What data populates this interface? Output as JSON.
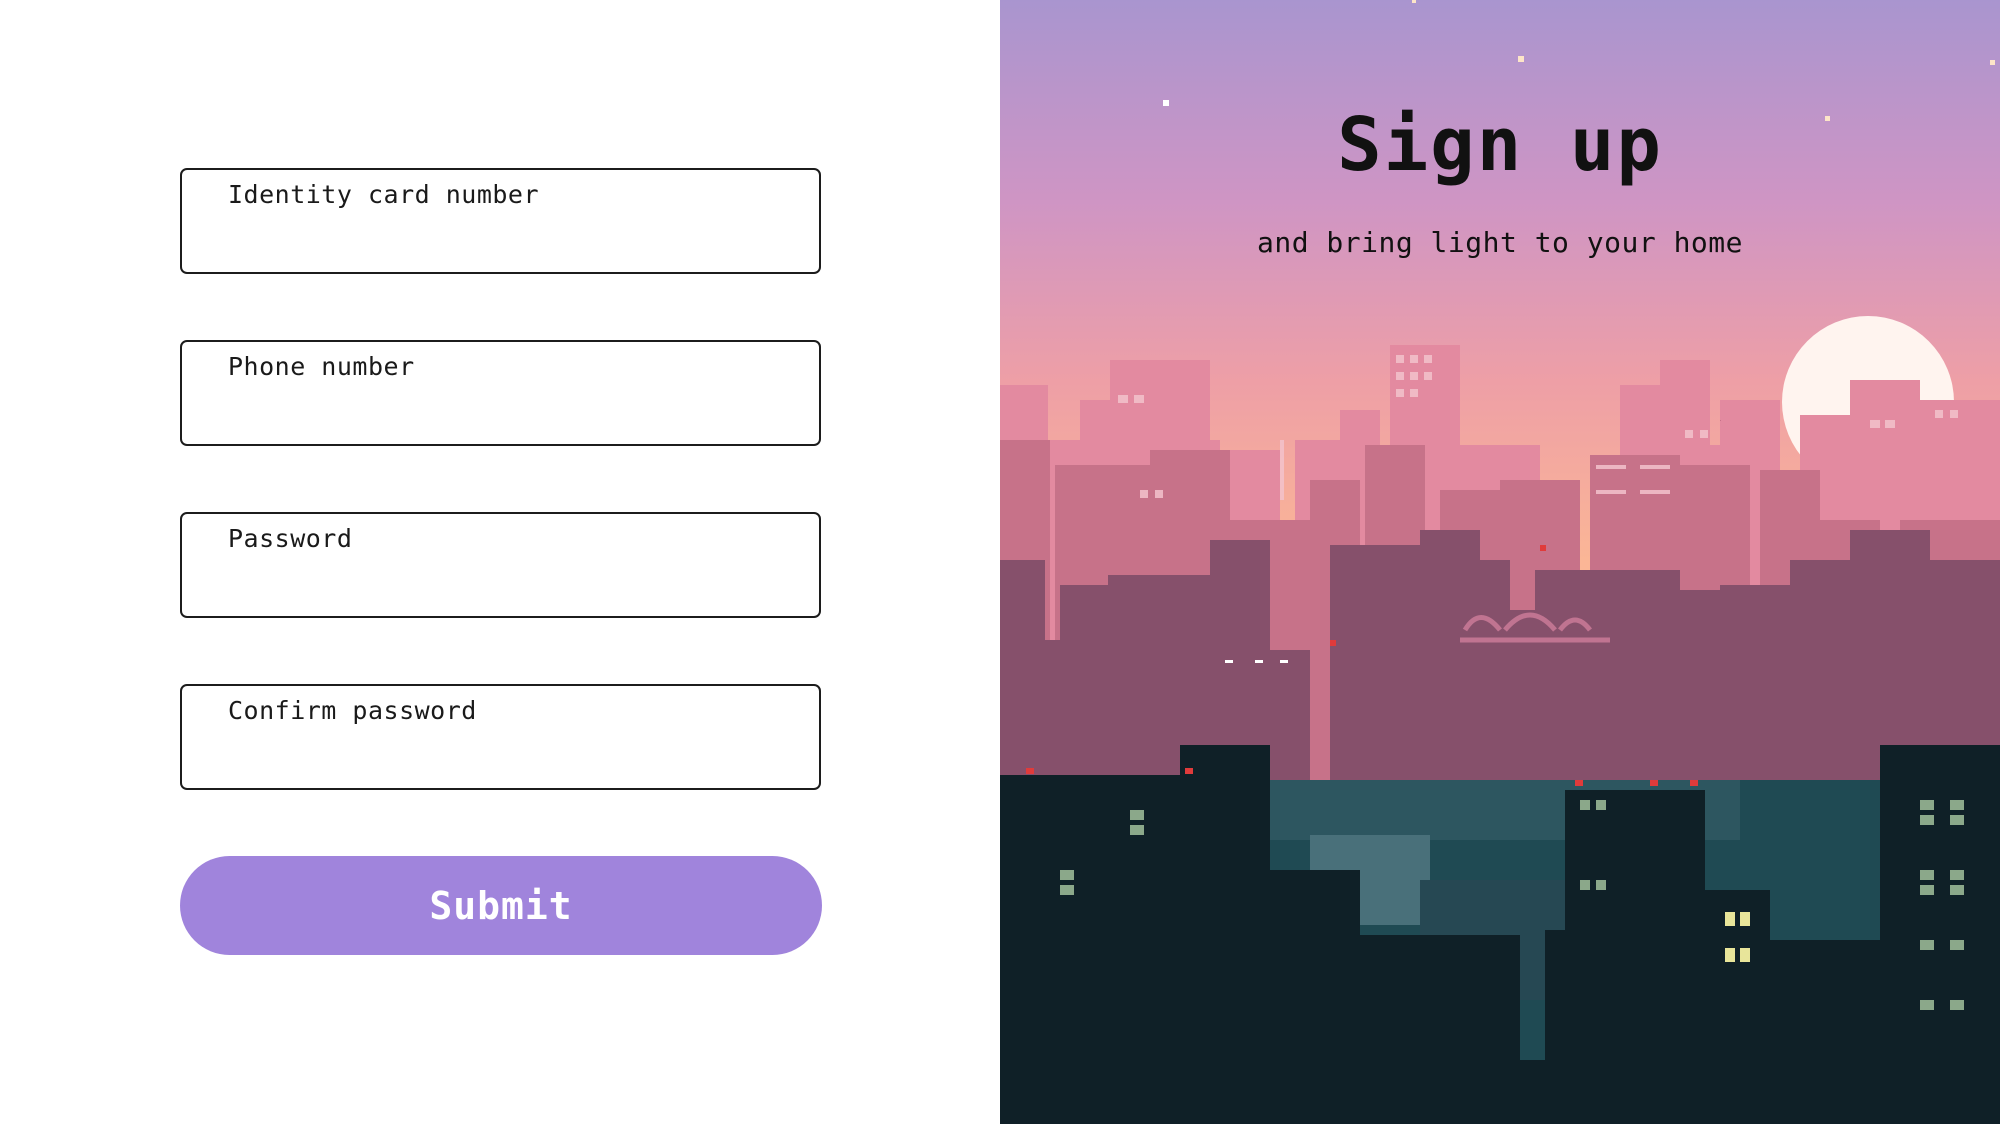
{
  "form": {
    "fields": [
      {
        "label": "Identity card number",
        "value": ""
      },
      {
        "label": "Phone number",
        "value": ""
      },
      {
        "label": "Password",
        "value": ""
      },
      {
        "label": "Confirm password",
        "value": ""
      }
    ],
    "submit_label": "Submit"
  },
  "hero": {
    "title": "Sign up",
    "subtitle": "and bring light to your home",
    "image": "pixel-art-city-sunset"
  },
  "colors": {
    "accent": "#a084dc",
    "sky_top": "#a995cf",
    "sky_mid": "#ef9fa4",
    "sky_low": "#fbb696",
    "sun": "#fff4ef",
    "city_dark": "#0f2027"
  }
}
